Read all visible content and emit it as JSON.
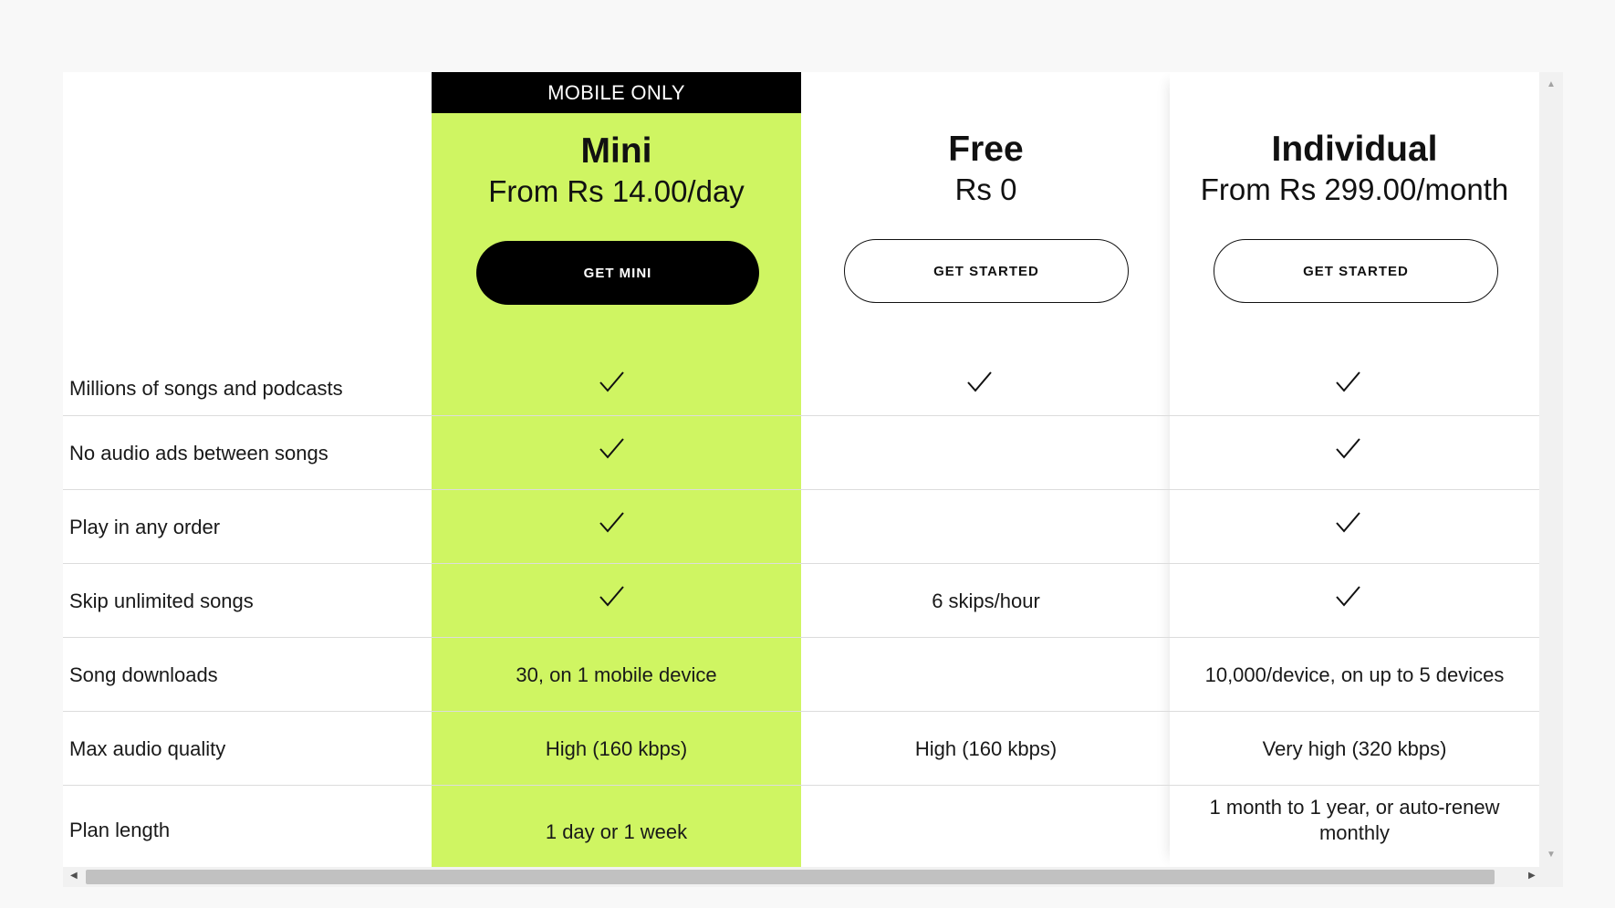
{
  "badge": "MOBILE ONLY",
  "plans": [
    {
      "name": "Mini",
      "price": "From Rs 14.00/day",
      "button": "GET MINI"
    },
    {
      "name": "Free",
      "price": "Rs 0",
      "button": "GET STARTED"
    },
    {
      "name": "Individual",
      "price": "From Rs 299.00/month",
      "button": "GET STARTED"
    }
  ],
  "features": [
    {
      "label": "Millions of songs and podcasts",
      "mini": "check",
      "free": "check",
      "individual": "check"
    },
    {
      "label": "No audio ads between songs",
      "mini": "check",
      "free": "",
      "individual": "check"
    },
    {
      "label": "Play in any order",
      "mini": "check",
      "free": "",
      "individual": "check"
    },
    {
      "label": "Skip unlimited songs",
      "mini": "check",
      "free": "6 skips/hour",
      "individual": "check"
    },
    {
      "label": "Song downloads",
      "mini": "30, on 1 mobile device",
      "free": "",
      "individual": "10,000/device, on up to 5 devices"
    },
    {
      "label": "Max audio quality",
      "mini": "High (160 kbps)",
      "free": "High (160 kbps)",
      "individual": "Very high (320 kbps)"
    },
    {
      "label": "Plan length",
      "mini": "1 day or 1 week",
      "free": "",
      "individual": "1 month to 1 year, or auto-renew monthly"
    }
  ],
  "icons": {
    "check": "checkmark-icon"
  },
  "colors": {
    "mini_bg": "#cff562",
    "badge_bg": "#000000"
  }
}
